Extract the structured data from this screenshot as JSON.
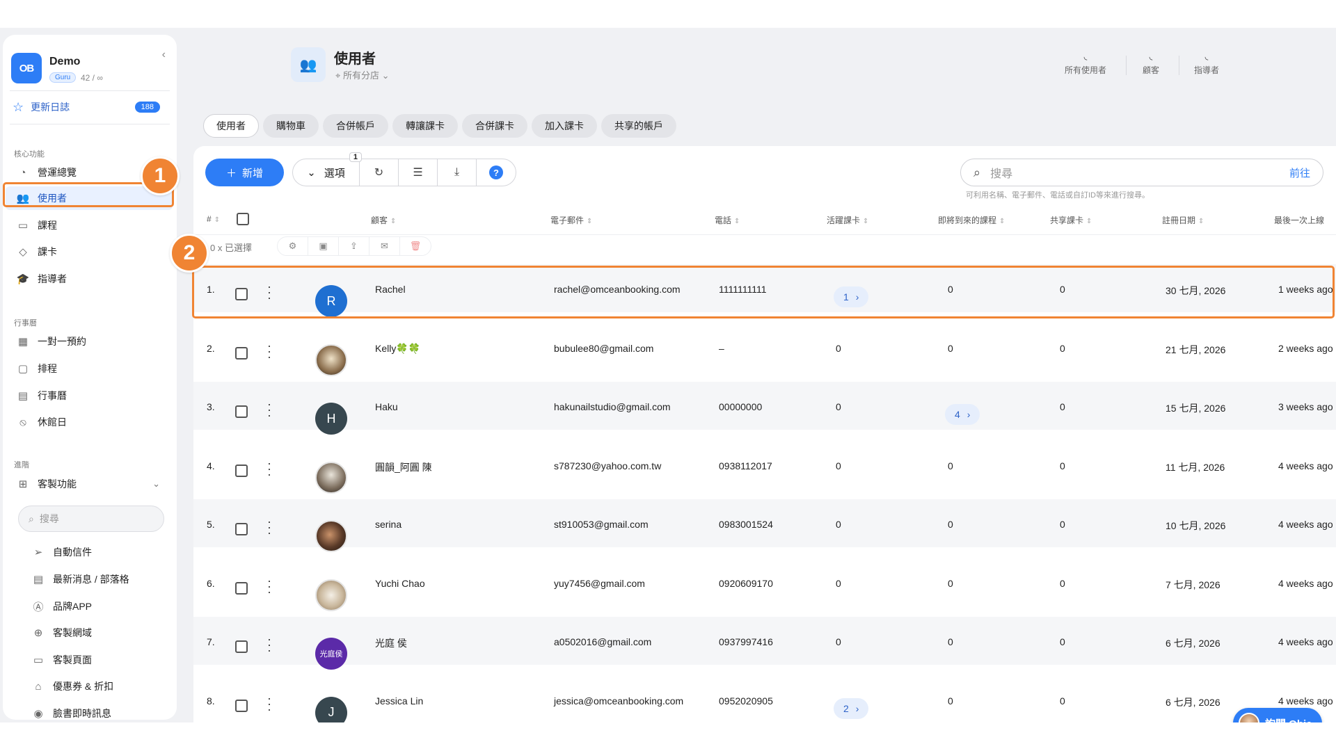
{
  "sidebar": {
    "brand": {
      "logo": "OB",
      "name": "Demo",
      "badge": "Guru",
      "count": "42 / ∞"
    },
    "changelog": {
      "label": "更新日誌",
      "count": "188"
    },
    "sections": {
      "core": "核心功能",
      "calendar": "行事曆",
      "advanced": "進階"
    },
    "core_items": [
      "營運總覽",
      "使用者",
      "課程",
      "課卡",
      "指導者"
    ],
    "calendar_items": [
      "一對一預約",
      "排程",
      "行事曆",
      "休館日"
    ],
    "custom_label": "客製功能",
    "search_placeholder": "搜尋",
    "sub_items": [
      "自動信件",
      "最新消息 / 部落格",
      "品牌APP",
      "客製網域",
      "客製頁面",
      "優惠券 & 折扣",
      "臉書即時訊息"
    ]
  },
  "header": {
    "title": "使用者",
    "location": "所有分店",
    "stats": [
      "所有使用者",
      "顧客",
      "指導者"
    ]
  },
  "tabs": [
    "使用者",
    "購物車",
    "合併帳戶",
    "轉讓課卡",
    "合併課卡",
    "加入課卡",
    "共享的帳戶"
  ],
  "toolbar": {
    "add_label": "新增",
    "options_label": "選項",
    "options_badge": "1",
    "help_label": "?"
  },
  "search": {
    "placeholder": "搜尋",
    "go_label": "前往",
    "hint": "可利用名稱、電子郵件、電話或自訂ID等來進行搜尋。"
  },
  "table": {
    "headers": [
      "#",
      "顧客",
      "電子郵件",
      "電話",
      "活躍課卡",
      "即將到來的課程",
      "共享課卡",
      "註冊日期",
      "最後一次上線"
    ],
    "bulk": {
      "selected": "0 x 已選擇"
    },
    "rows": [
      {
        "num": "1.",
        "name": "Rachel",
        "initial": "R",
        "avatar_color": "#1f6fd1",
        "email": "rachel@omceanbooking.com",
        "phone": "1111111111",
        "active": "1",
        "active_link": true,
        "upcoming": "0",
        "upcoming_link": false,
        "shared": "0",
        "registered": "30 七月, 2026",
        "last": "1 weeks ago"
      },
      {
        "num": "2.",
        "name": "Kelly🍀🍀",
        "initial": "",
        "avatar_color": "",
        "email": "bubulee80@gmail.com",
        "phone": "–",
        "active": "0",
        "active_link": false,
        "upcoming": "0",
        "upcoming_link": false,
        "shared": "0",
        "registered": "21 七月, 2026",
        "last": "2 weeks ago"
      },
      {
        "num": "3.",
        "name": "Haku",
        "initial": "H",
        "avatar_color": "#37474f",
        "email": "hakunailstudio@gmail.com",
        "phone": "00000000",
        "active": "0",
        "active_link": false,
        "upcoming": "4",
        "upcoming_link": true,
        "shared": "0",
        "registered": "15 七月, 2026",
        "last": "3 weeks ago"
      },
      {
        "num": "4.",
        "name": "圓韻_阿圓 陳",
        "initial": "",
        "avatar_color": "",
        "email": "s787230@yahoo.com.tw",
        "phone": "0938112017",
        "active": "0",
        "active_link": false,
        "upcoming": "0",
        "upcoming_link": false,
        "shared": "0",
        "registered": "11 七月, 2026",
        "last": "4 weeks ago"
      },
      {
        "num": "5.",
        "name": "serina",
        "initial": "",
        "avatar_color": "",
        "email": "st910053@gmail.com",
        "phone": "0983001524",
        "active": "0",
        "active_link": false,
        "upcoming": "0",
        "upcoming_link": false,
        "shared": "0",
        "registered": "10 七月, 2026",
        "last": "4 weeks ago"
      },
      {
        "num": "6.",
        "name": "Yuchi Chao",
        "initial": "",
        "avatar_color": "",
        "email": "yuy7456@gmail.com",
        "phone": "0920609170",
        "active": "0",
        "active_link": false,
        "upcoming": "0",
        "upcoming_link": false,
        "shared": "0",
        "registered": "7 七月, 2026",
        "last": "4 weeks ago"
      },
      {
        "num": "7.",
        "name": "光庭 侯",
        "initial": "光庭侯",
        "avatar_color": "#5b2aa8",
        "email": "a0502016@gmail.com",
        "phone": "0937997416",
        "active": "0",
        "active_link": false,
        "upcoming": "0",
        "upcoming_link": false,
        "shared": "0",
        "registered": "6 七月, 2026",
        "last": "4 weeks ago"
      },
      {
        "num": "8.",
        "name": "Jessica Lin",
        "initial": "J",
        "avatar_color": "#37474f",
        "email": "jessica@omceanbooking.com",
        "phone": "0952020905",
        "active": "2",
        "active_link": true,
        "upcoming": "0",
        "upcoming_link": false,
        "shared": "0",
        "registered": "6 七月, 2026",
        "last": "4 weeks ago"
      }
    ]
  },
  "annotations": [
    "1",
    "2"
  ],
  "assistant": {
    "label": "詢問 Obie"
  },
  "colors": {
    "accent": "#2d7df6",
    "annotation": "#f08433",
    "active_nav_bg": "#e9f1ff"
  }
}
